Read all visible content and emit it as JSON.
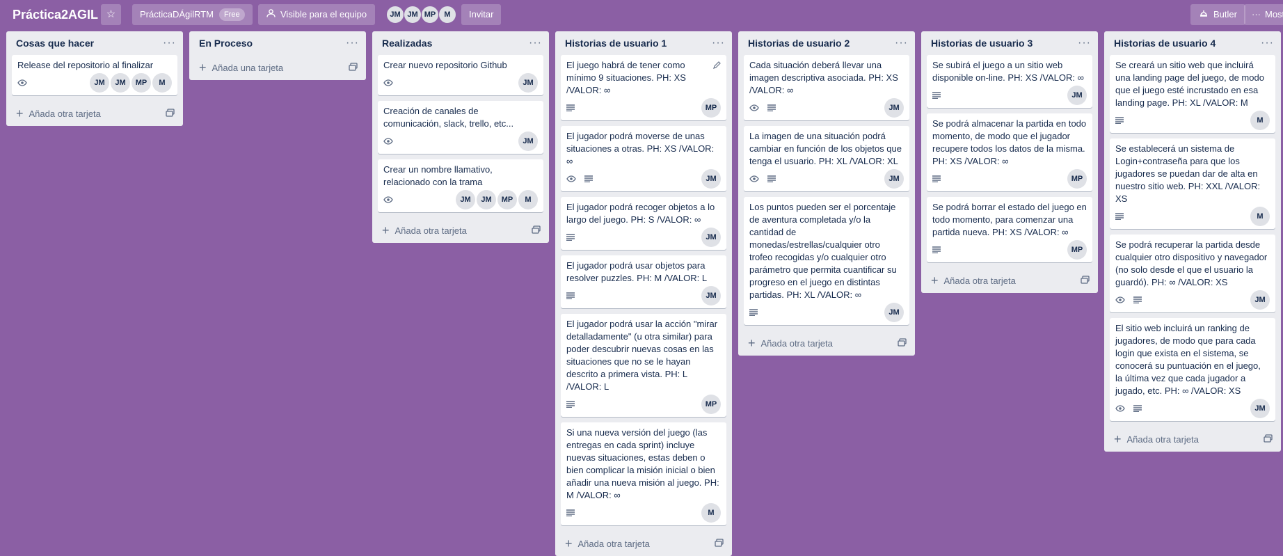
{
  "header": {
    "board_title": "Práctica2AGIL",
    "star_icon": "star-icon",
    "team_name": "PrácticaDÁgilRTM",
    "team_badge": "Free",
    "visibility_label": "Visible para el equipo",
    "members": [
      "JM",
      "JM",
      "MP",
      "M"
    ],
    "invite_label": "Invitar",
    "butler_label": "Butler",
    "more_label": "Mostrar menú"
  },
  "add_card_label": "Añada otra tarjeta",
  "add_first_card_label": "Añada una tarjeta",
  "lists": [
    {
      "title": "Cosas que hacer",
      "cards": [
        {
          "text": "Release del repositorio al finalizar",
          "watch": true,
          "desc": false,
          "members": [
            "JM",
            "JM",
            "MP",
            "M"
          ]
        }
      ]
    },
    {
      "title": "En Proceso",
      "cards": []
    },
    {
      "title": "Realizadas",
      "cards": [
        {
          "text": "Crear nuevo repositorio Github",
          "watch": true,
          "desc": false,
          "members": [
            "JM"
          ]
        },
        {
          "text": "Creación de canales de comunicación, slack, trello, etc...",
          "watch": true,
          "desc": false,
          "members": [
            "JM"
          ]
        },
        {
          "text": "Crear un nombre llamativo, relacionado con la trama",
          "watch": true,
          "desc": false,
          "members": [
            "JM",
            "JM",
            "MP",
            "M"
          ]
        }
      ]
    },
    {
      "title": "Historias de usuario 1",
      "cards": [
        {
          "text": "El juego habrá de tener como mínimo 9 situaciones. PH: XS /VALOR: ∞",
          "watch": false,
          "desc": true,
          "members": [
            "MP"
          ],
          "editing": true
        },
        {
          "text": "El jugador podrá moverse de unas situaciones a otras. PH: XS /VALOR: ∞",
          "watch": true,
          "desc": true,
          "members": [
            "JM"
          ]
        },
        {
          "text": "El jugador podrá recoger objetos a lo largo del juego. PH: S /VALOR: ∞",
          "watch": false,
          "desc": true,
          "members": [
            "JM"
          ]
        },
        {
          "text": "El jugador podrá usar objetos para resolver puzzles. PH: M /VALOR: L",
          "watch": false,
          "desc": true,
          "members": [
            "JM"
          ]
        },
        {
          "text": "El jugador podrá usar la acción \"mirar detalladamente\" (u otra similar) para poder descubrir nuevas cosas en las situaciones que no se le hayan descrito a primera vista. PH: L /VALOR: L",
          "watch": false,
          "desc": true,
          "members": [
            "MP"
          ]
        },
        {
          "text": "Si una nueva versión del juego (las entregas en cada sprint) incluye nuevas situaciones, estas deben o bien complicar la misión inicial o bien añadir una nueva misión al juego. PH: M /VALOR: ∞",
          "watch": false,
          "desc": true,
          "members": [
            "M"
          ]
        }
      ]
    },
    {
      "title": "Historias de usuario 2",
      "cards": [
        {
          "text": "Cada situación deberá llevar una imagen descriptiva asociada. PH: XS /VALOR: ∞",
          "watch": true,
          "desc": true,
          "members": [
            "JM"
          ]
        },
        {
          "text": "La imagen de una situación podrá cambiar en función de los objetos que tenga el usuario. PH: XL /VALOR: XL",
          "watch": true,
          "desc": true,
          "members": [
            "JM"
          ]
        },
        {
          "text": "Los puntos pueden ser el porcentaje de aventura completada y/o la cantidad de monedas/estrellas/cualquier otro trofeo recogidas y/o cualquier otro parámetro que permita cuantificar su progreso en el juego en distintas partidas. PH: XL /VALOR: ∞",
          "watch": false,
          "desc": true,
          "members": [
            "JM"
          ]
        }
      ]
    },
    {
      "title": "Historias de usuario 3",
      "cards": [
        {
          "text": "Se subirá el juego a un sitio web disponible on-line. PH: XS /VALOR: ∞",
          "watch": false,
          "desc": true,
          "members": [
            "JM"
          ]
        },
        {
          "text": "Se podrá almacenar la partida en todo momento, de modo que el jugador recupere todos los datos de la misma. PH: XS /VALOR: ∞",
          "watch": false,
          "desc": true,
          "members": [
            "MP"
          ]
        },
        {
          "text": "Se podrá borrar el estado del juego en todo momento, para comenzar una partida nueva. PH: XS /VALOR: ∞",
          "watch": false,
          "desc": true,
          "members": [
            "MP"
          ]
        }
      ]
    },
    {
      "title": "Historias de usuario 4",
      "cards": [
        {
          "text": "Se creará un sitio web que incluirá una landing page del juego, de modo que el juego esté incrustado en esa landing page. PH: XL /VALOR: M",
          "watch": false,
          "desc": true,
          "members": [
            "M"
          ]
        },
        {
          "text": "Se establecerá un sistema de Login+contraseña para que los jugadores se puedan dar de alta en nuestro sitio web. PH: XXL /VALOR: XS",
          "watch": false,
          "desc": true,
          "members": [
            "M"
          ]
        },
        {
          "text": "Se podrá recuperar la partida desde cualquier otro dispositivo y navegador (no solo desde el que el usuario la guardó). PH: ∞ /VALOR: XS",
          "watch": true,
          "desc": true,
          "members": [
            "JM"
          ]
        },
        {
          "text": "El sitio web incluirá un ranking de jugadores, de modo que para cada login que exista en el sistema, se conocerá su puntuación en el juego, la última vez que cada jugador a jugado, etc. PH: ∞ /VALOR: XS",
          "watch": true,
          "desc": true,
          "members": [
            "JM"
          ]
        }
      ]
    }
  ]
}
